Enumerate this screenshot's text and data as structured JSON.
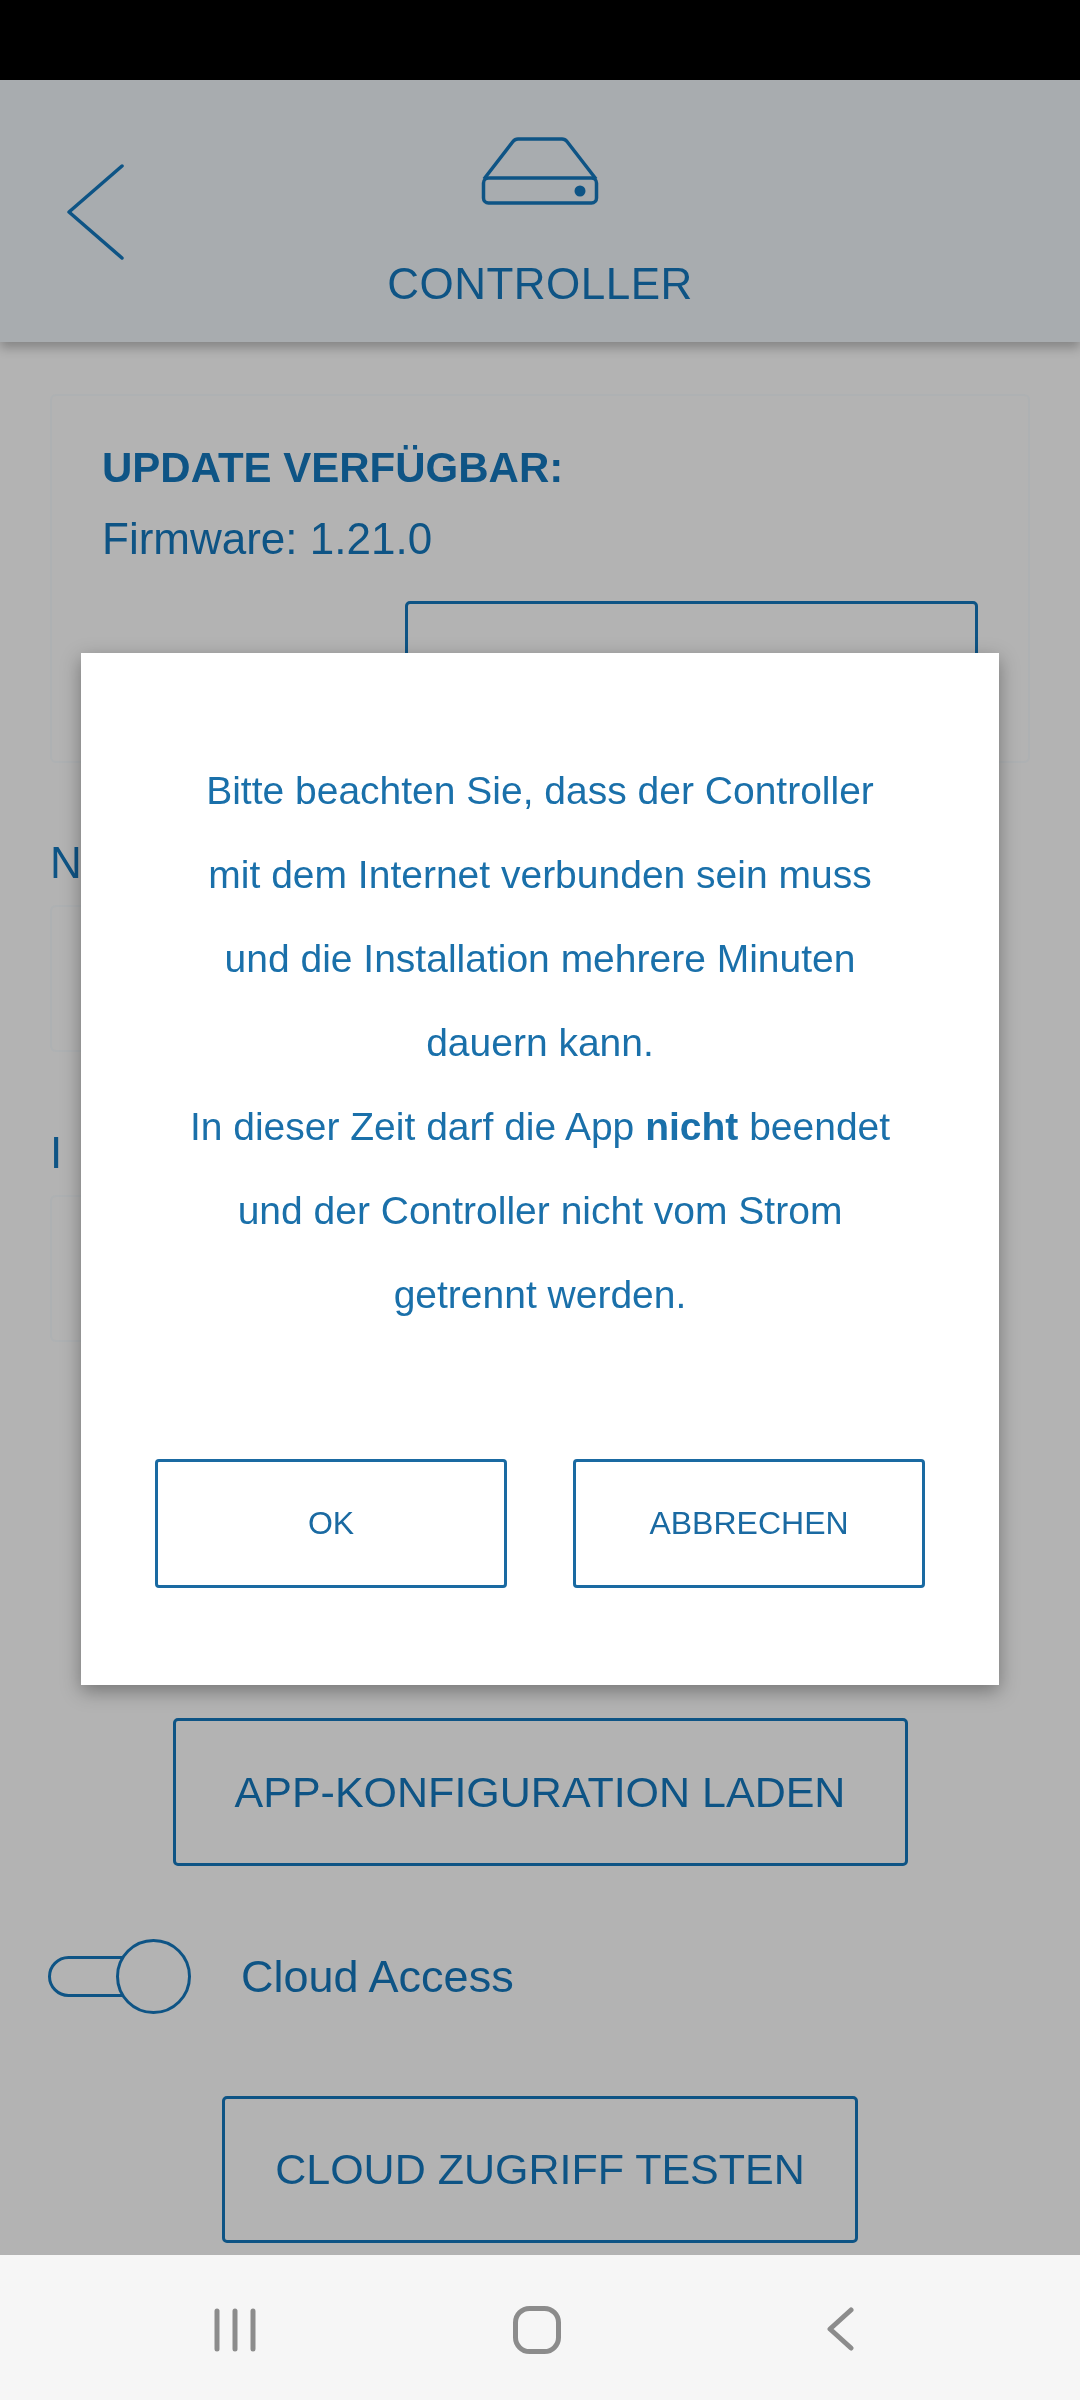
{
  "header": {
    "title": "CONTROLLER"
  },
  "update_card": {
    "title": "UPDATE VERFÜGBAR:",
    "firmware": "Firmware: 1.21.0"
  },
  "fields": [
    {
      "label": "N"
    },
    {
      "label": "I"
    }
  ],
  "actions": {
    "load_button": "APP-KONFIGURATION LADEN",
    "cloud_access": {
      "label": "Cloud Access",
      "on": true
    },
    "test_button": "CLOUD ZUGRIFF TESTEN"
  },
  "dialog": {
    "paragraphs": [
      "Bitte beachten Sie, dass der Controller\nmit dem Internet verbunden sein muss\nund die Installation mehrere Minuten\ndauern kann.",
      "In dieser Zeit darf die App **nicht** beendet\nund der Controller nicht vom Strom\ngetrennt werden."
    ],
    "buttons": [
      "OK",
      "ABBRECHEN"
    ]
  }
}
